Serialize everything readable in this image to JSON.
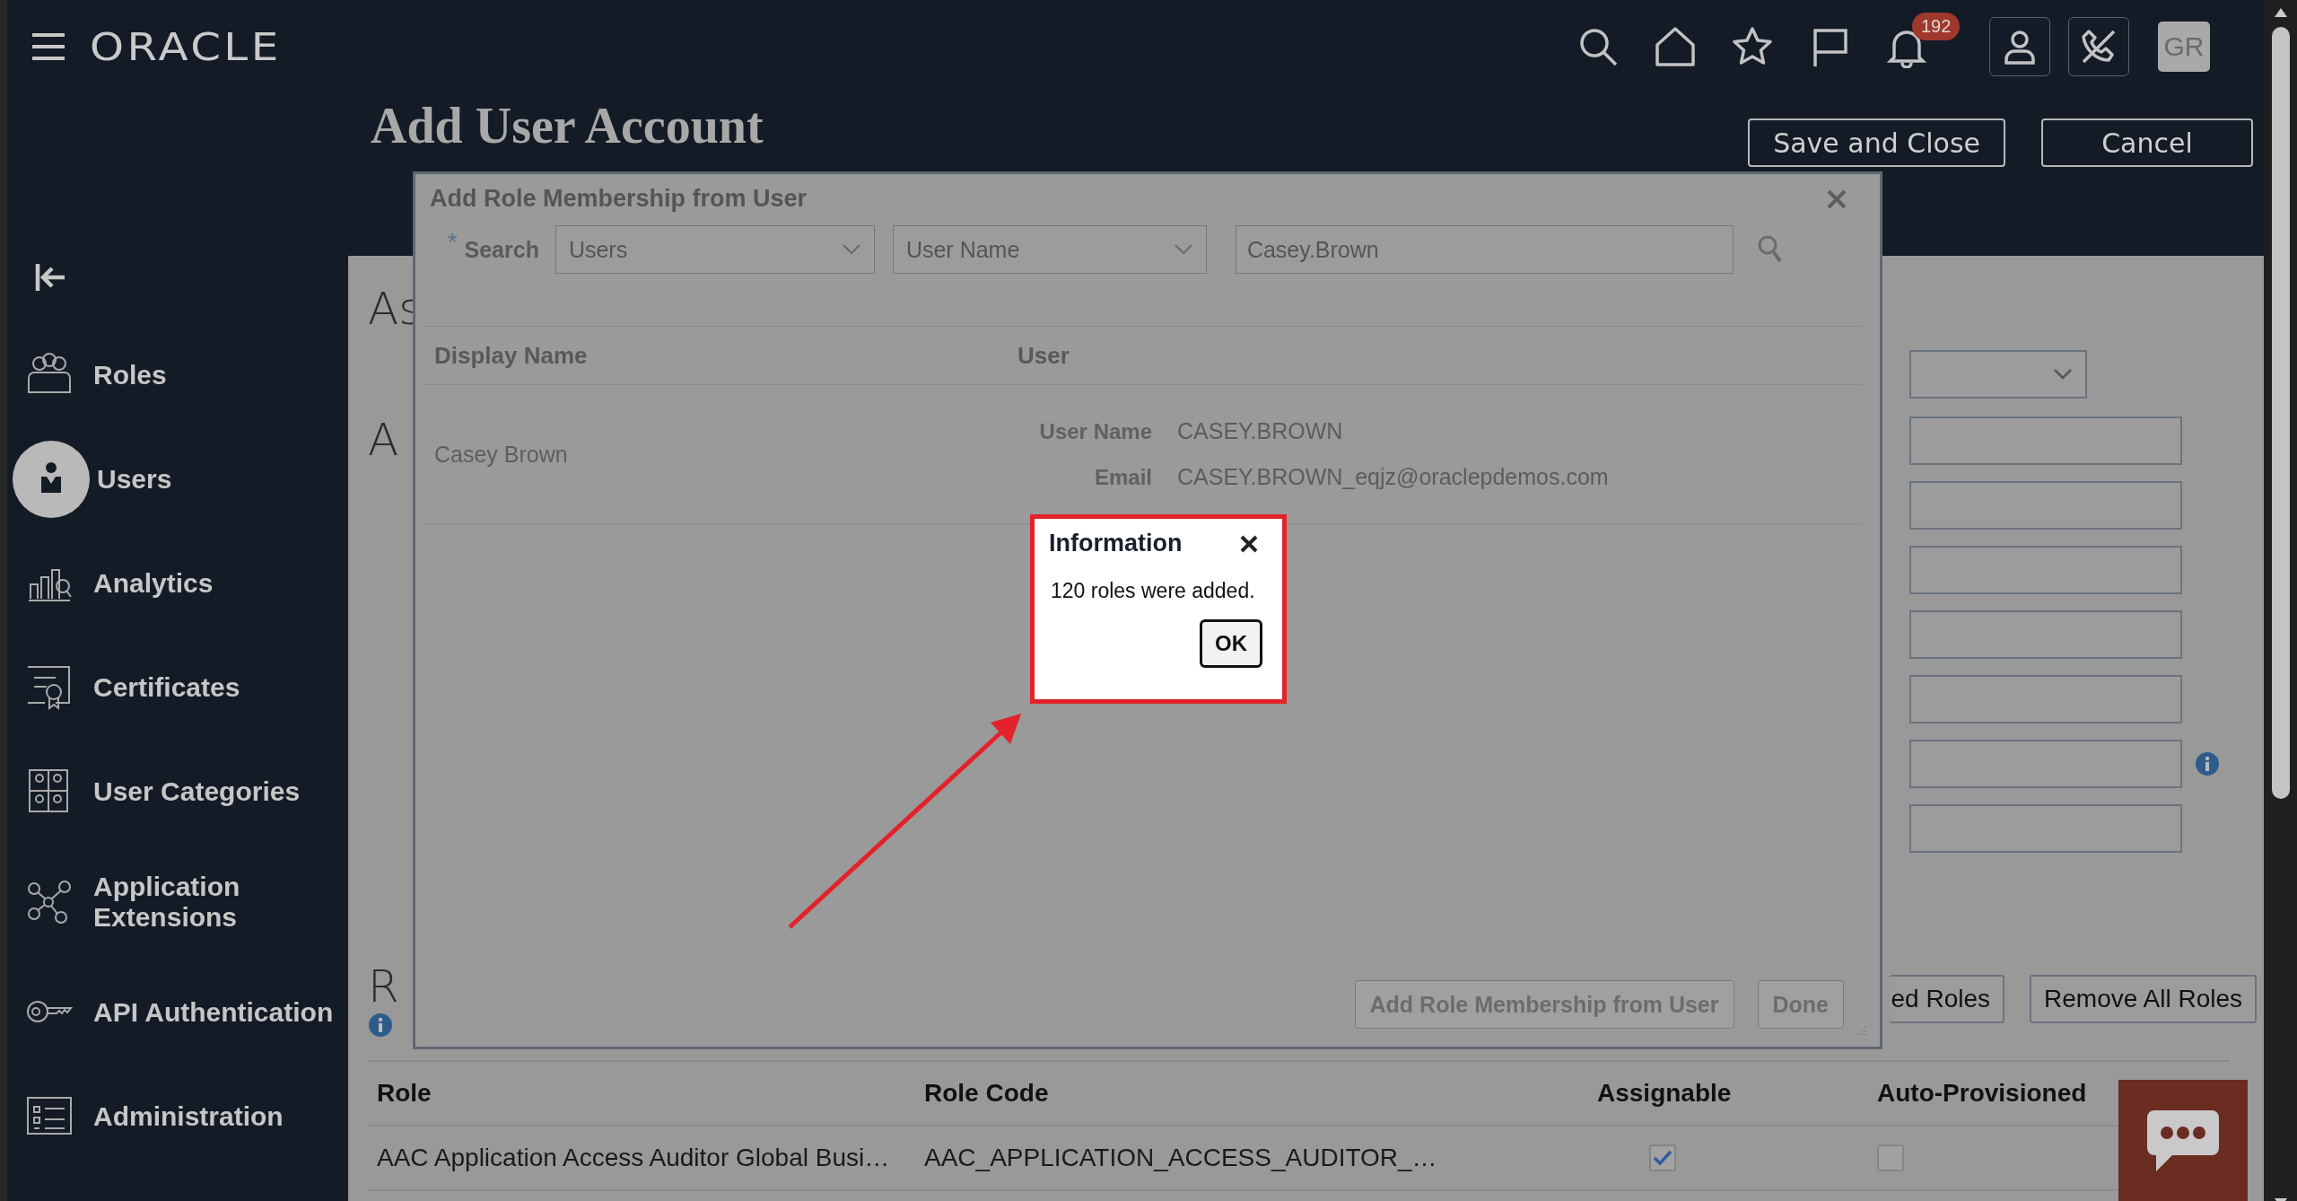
{
  "top_bar": {
    "logo": "ORACLE",
    "notification_count": "192",
    "avatar_initials": "GR"
  },
  "page": {
    "title": "Add User Account",
    "buttons": [
      {
        "label": "Save and Close"
      },
      {
        "label": "Cancel"
      }
    ]
  },
  "sidebar": {
    "items": [
      {
        "label": "Roles",
        "selected": false
      },
      {
        "label": "Users",
        "selected": true
      },
      {
        "label": "Analytics",
        "selected": false
      },
      {
        "label": "Certificates",
        "selected": false
      },
      {
        "label": "User Categories",
        "selected": false
      },
      {
        "label": "Application Extensions",
        "selected": false
      },
      {
        "label": "API Authentication",
        "selected": false
      },
      {
        "label": "Administration",
        "selected": false
      }
    ]
  },
  "content": {
    "section_headings": [
      "As",
      "A"
    ],
    "form_fields": [
      {
        "kind": "select",
        "info": false
      },
      {
        "kind": "text",
        "info": false
      },
      {
        "kind": "text",
        "info": false
      },
      {
        "kind": "text",
        "info": false
      },
      {
        "kind": "text",
        "info": false
      },
      {
        "kind": "text",
        "info": false
      },
      {
        "kind": "text",
        "info": true
      },
      {
        "kind": "text",
        "info": false
      }
    ],
    "roles_heading": "R",
    "role_buttons": [
      {
        "label": "ed Roles"
      },
      {
        "label": "Remove All Roles"
      }
    ],
    "roles_table": {
      "columns": [
        "Role",
        "Role Code",
        "Assignable",
        "Auto-Provisioned"
      ],
      "rows": [
        {
          "role": "AAC Application Access Auditor Global Busi…",
          "role_code": "AAC_APPLICATION_ACCESS_AUDITOR_…",
          "assignable": true,
          "auto_provisioned": false
        }
      ]
    }
  },
  "dialog": {
    "title": "Add Role Membership from User",
    "search": {
      "required_mark": "*",
      "label": "Search",
      "scope": "Users",
      "attribute": "User Name",
      "value": "Casey.Brown"
    },
    "results": {
      "columns": [
        "Display Name",
        "User"
      ],
      "rows": [
        {
          "display_name": "Casey Brown",
          "fields": [
            {
              "label": "User Name",
              "value": "CASEY.BROWN"
            },
            {
              "label": "Email",
              "value": "CASEY.BROWN_eqjz@oraclepdemos.com"
            }
          ]
        }
      ]
    },
    "buttons": [
      {
        "label": "Add Role Membership from User"
      },
      {
        "label": "Done"
      }
    ]
  },
  "information_popup": {
    "title": "Information",
    "message": "120 roles were added.",
    "button": "OK"
  }
}
